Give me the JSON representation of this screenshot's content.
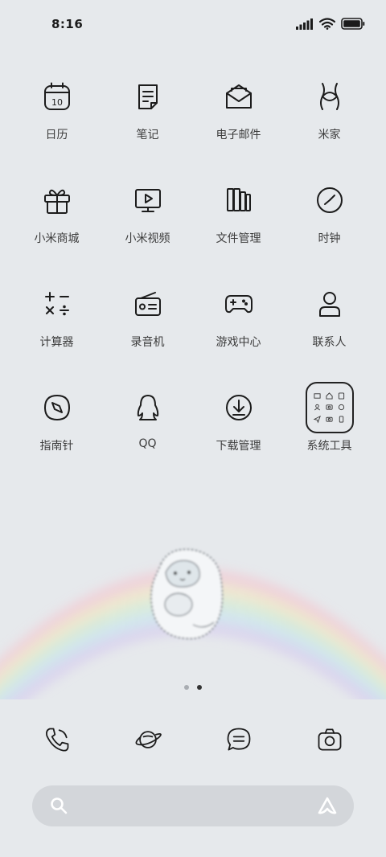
{
  "status_bar": {
    "time": "8:16"
  },
  "apps": [
    {
      "label": "日历",
      "icon": "calendar-icon",
      "date": "10"
    },
    {
      "label": "笔记",
      "icon": "notes-icon"
    },
    {
      "label": "电子邮件",
      "icon": "email-icon"
    },
    {
      "label": "米家",
      "icon": "mijia-icon"
    },
    {
      "label": "小米商城",
      "icon": "gift-icon"
    },
    {
      "label": "小米视频",
      "icon": "video-icon"
    },
    {
      "label": "文件管理",
      "icon": "files-icon"
    },
    {
      "label": "时钟",
      "icon": "clock-icon"
    },
    {
      "label": "计算器",
      "icon": "calculator-icon"
    },
    {
      "label": "录音机",
      "icon": "radio-icon"
    },
    {
      "label": "游戏中心",
      "icon": "gamepad-icon"
    },
    {
      "label": "联系人",
      "icon": "person-icon"
    },
    {
      "label": "指南针",
      "icon": "compass-icon"
    },
    {
      "label": "QQ",
      "icon": "penguin-icon"
    },
    {
      "label": "下载管理",
      "icon": "download-icon"
    },
    {
      "label": "系统工具",
      "icon": "folder-icon"
    }
  ],
  "page_indicator": {
    "current": 2,
    "total": 2
  },
  "dock": [
    {
      "icon": "phone-icon"
    },
    {
      "icon": "planet-icon"
    },
    {
      "icon": "message-icon"
    },
    {
      "icon": "camera-icon"
    }
  ],
  "search": {
    "icon": "search-icon",
    "assistant_icon": "assistant-icon"
  }
}
